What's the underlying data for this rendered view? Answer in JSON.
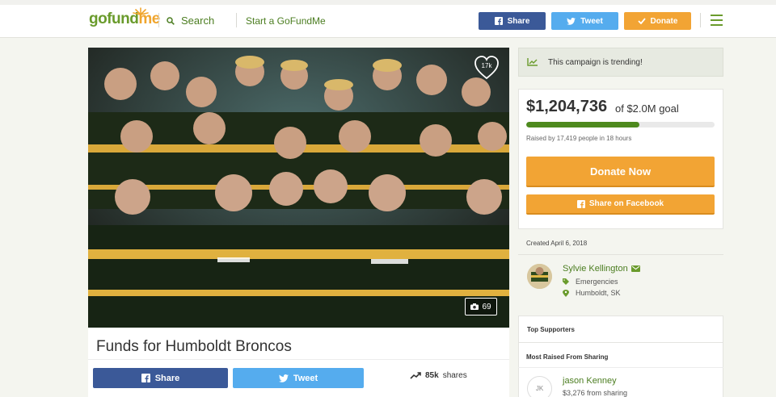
{
  "header": {
    "logo_main": "gofund",
    "logo_me": "me",
    "search_label": "Search",
    "start_label": "Start a GoFundMe",
    "share_label": "Share",
    "tweet_label": "Tweet",
    "donate_label": "Donate"
  },
  "media": {
    "heart_count": "17k",
    "photo_count": "69"
  },
  "campaign": {
    "title": "Funds for Humboldt Broncos",
    "share_label": "Share",
    "tweet_label": "Tweet",
    "shares_count": "85k",
    "shares_text": "shares"
  },
  "sidebar": {
    "trending_text": "This campaign is trending!",
    "amount": "$1,204,736",
    "goal_text": "of $2.0M goal",
    "progress_fraction": 0.6,
    "raised_by": "Raised by 17,419 people in 18 hours",
    "donate_now": "Donate Now",
    "share_facebook": "Share on Facebook",
    "created": "Created April 6, 2018",
    "organizer_name": "Sylvie Kellington",
    "category": "Emergencies",
    "location": "Humboldt, SK",
    "top_supporters": "Top Supporters",
    "most_raised": "Most Raised From Sharing",
    "supporter_initials": "JK",
    "supporter_name": "jason Kenney",
    "supporter_amount": "$3,276 from sharing"
  },
  "colors": {
    "brand_green": "#6a9b2c",
    "brand_orange": "#f2a434",
    "facebook": "#3b5998",
    "twitter": "#55acee"
  }
}
